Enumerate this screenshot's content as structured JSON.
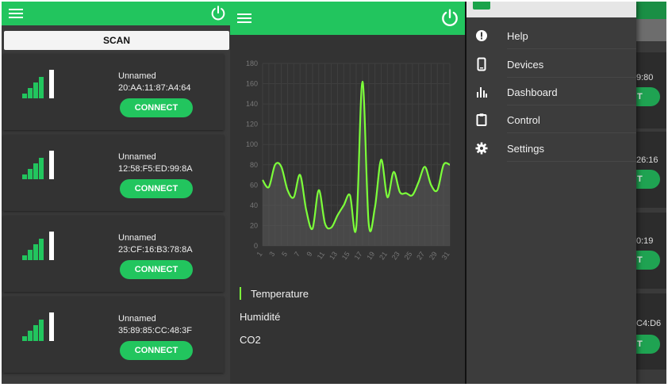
{
  "colors": {
    "accent": "#22c55e",
    "line": "#7cff3a",
    "card": "#333333",
    "panel": "#3b3b3b"
  },
  "scan_panel": {
    "scan_label": "SCAN",
    "devices": [
      {
        "name": "Unnamed",
        "mac": "20:AA:11:87:A4:64",
        "connect_label": "CONNECT"
      },
      {
        "name": "Unnamed",
        "mac": "12:58:F5:ED:99:8A",
        "connect_label": "CONNECT"
      },
      {
        "name": "Unnamed",
        "mac": "23:CF:16:B3:78:8A",
        "connect_label": "CONNECT"
      },
      {
        "name": "Unnamed",
        "mac": "35:89:85:CC:48:3F",
        "connect_label": "CONNECT"
      }
    ]
  },
  "chart_panel": {
    "legend": [
      "Temperature",
      "Humidité",
      "CO2"
    ],
    "active_legend": "Temperature"
  },
  "chart_data": {
    "type": "line",
    "title": "",
    "xlabel": "",
    "ylabel": "",
    "ylim": [
      0,
      180
    ],
    "yticks": [
      0,
      20,
      40,
      60,
      80,
      100,
      120,
      140,
      160,
      180
    ],
    "xlim": [
      1,
      31
    ],
    "xticks": [
      1,
      3,
      5,
      7,
      9,
      11,
      13,
      15,
      17,
      19,
      21,
      23,
      25,
      27,
      29,
      31
    ],
    "grid": true,
    "series": [
      {
        "name": "Temperature",
        "x": [
          1,
          2,
          3,
          4,
          5,
          6,
          7,
          8,
          9,
          10,
          11,
          12,
          13,
          14,
          15,
          16,
          17,
          18,
          19,
          20,
          21,
          22,
          23,
          24,
          25,
          26,
          27,
          28,
          29,
          30,
          31
        ],
        "values": [
          65,
          58,
          80,
          78,
          55,
          48,
          70,
          35,
          17,
          55,
          22,
          18,
          30,
          40,
          50,
          18,
          162,
          22,
          38,
          85,
          48,
          73,
          53,
          52,
          50,
          63,
          78,
          60,
          55,
          80,
          80
        ]
      }
    ]
  },
  "drawer": {
    "items": [
      {
        "label": "Help",
        "icon": "help-icon"
      },
      {
        "label": "Devices",
        "icon": "phone-icon"
      },
      {
        "label": "Dashboard",
        "icon": "bar-chart-icon"
      },
      {
        "label": "Control",
        "icon": "clipboard-icon"
      },
      {
        "label": "Settings",
        "icon": "gear-icon"
      }
    ]
  },
  "background_screen": {
    "mac_fragments": [
      "9:80",
      "26:16",
      "0:19",
      "C4:D6"
    ],
    "button_fragment": "T"
  }
}
